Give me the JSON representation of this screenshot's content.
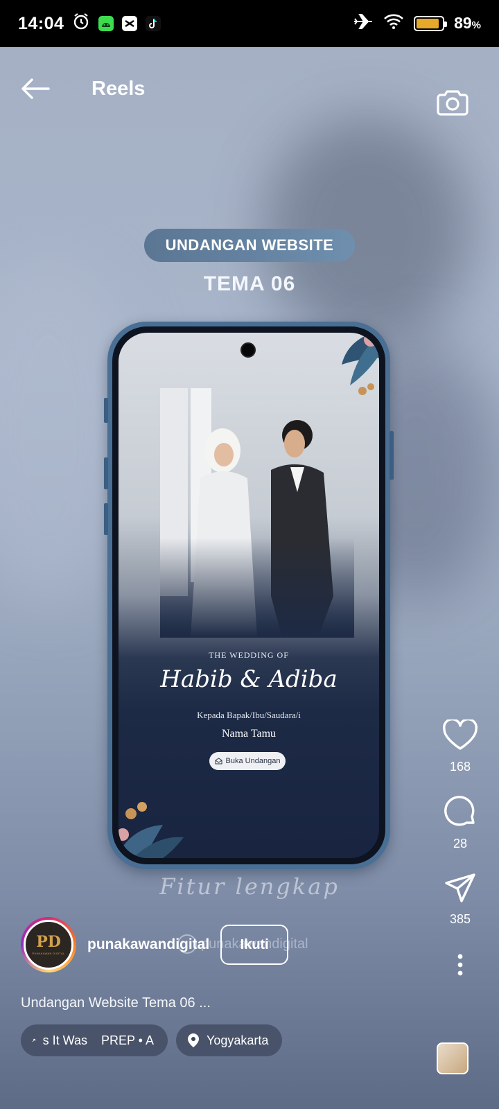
{
  "status_bar": {
    "time": "14:04",
    "battery_percent": "89",
    "battery_suffix": "%",
    "battery_level": 0.89,
    "notification_icons": [
      "alarm-icon",
      "android-app-icon",
      "capcut-icon",
      "tiktok-icon"
    ],
    "system_icons": [
      "airplane-icon",
      "wifi-icon",
      "battery-icon"
    ]
  },
  "header": {
    "title": "Reels"
  },
  "video": {
    "tag": "UNDANGAN WEBSITE",
    "theme": "TEMA 06",
    "invite": {
      "wedding_of": "THE WEDDING OF",
      "names": "Habib & Adiba",
      "recipient_label": "Kepada Bapak/Ibu/Saudara/i",
      "guest_name": "Nama Tamu",
      "open_button": "Buka Undangan"
    },
    "overlay_text": "Fitur lengkap",
    "watermark": "punakawandigital"
  },
  "actions": {
    "likes": "168",
    "comments": "28",
    "shares": "385"
  },
  "author": {
    "username": "punakawandigital",
    "follow_label": "Ikuti",
    "avatar_logo": "PD",
    "avatar_sub": "PUNAKAWAN DIGITAL"
  },
  "caption": "Undangan Website Tema 06 ...",
  "chips": {
    "audio": "s It Was    PREP • A",
    "location": "Yogyakarta"
  },
  "colors": {
    "accent_battery": "#e5a82a",
    "pill_bg": "#5a7693",
    "phone_frame": "#4a6f95"
  }
}
